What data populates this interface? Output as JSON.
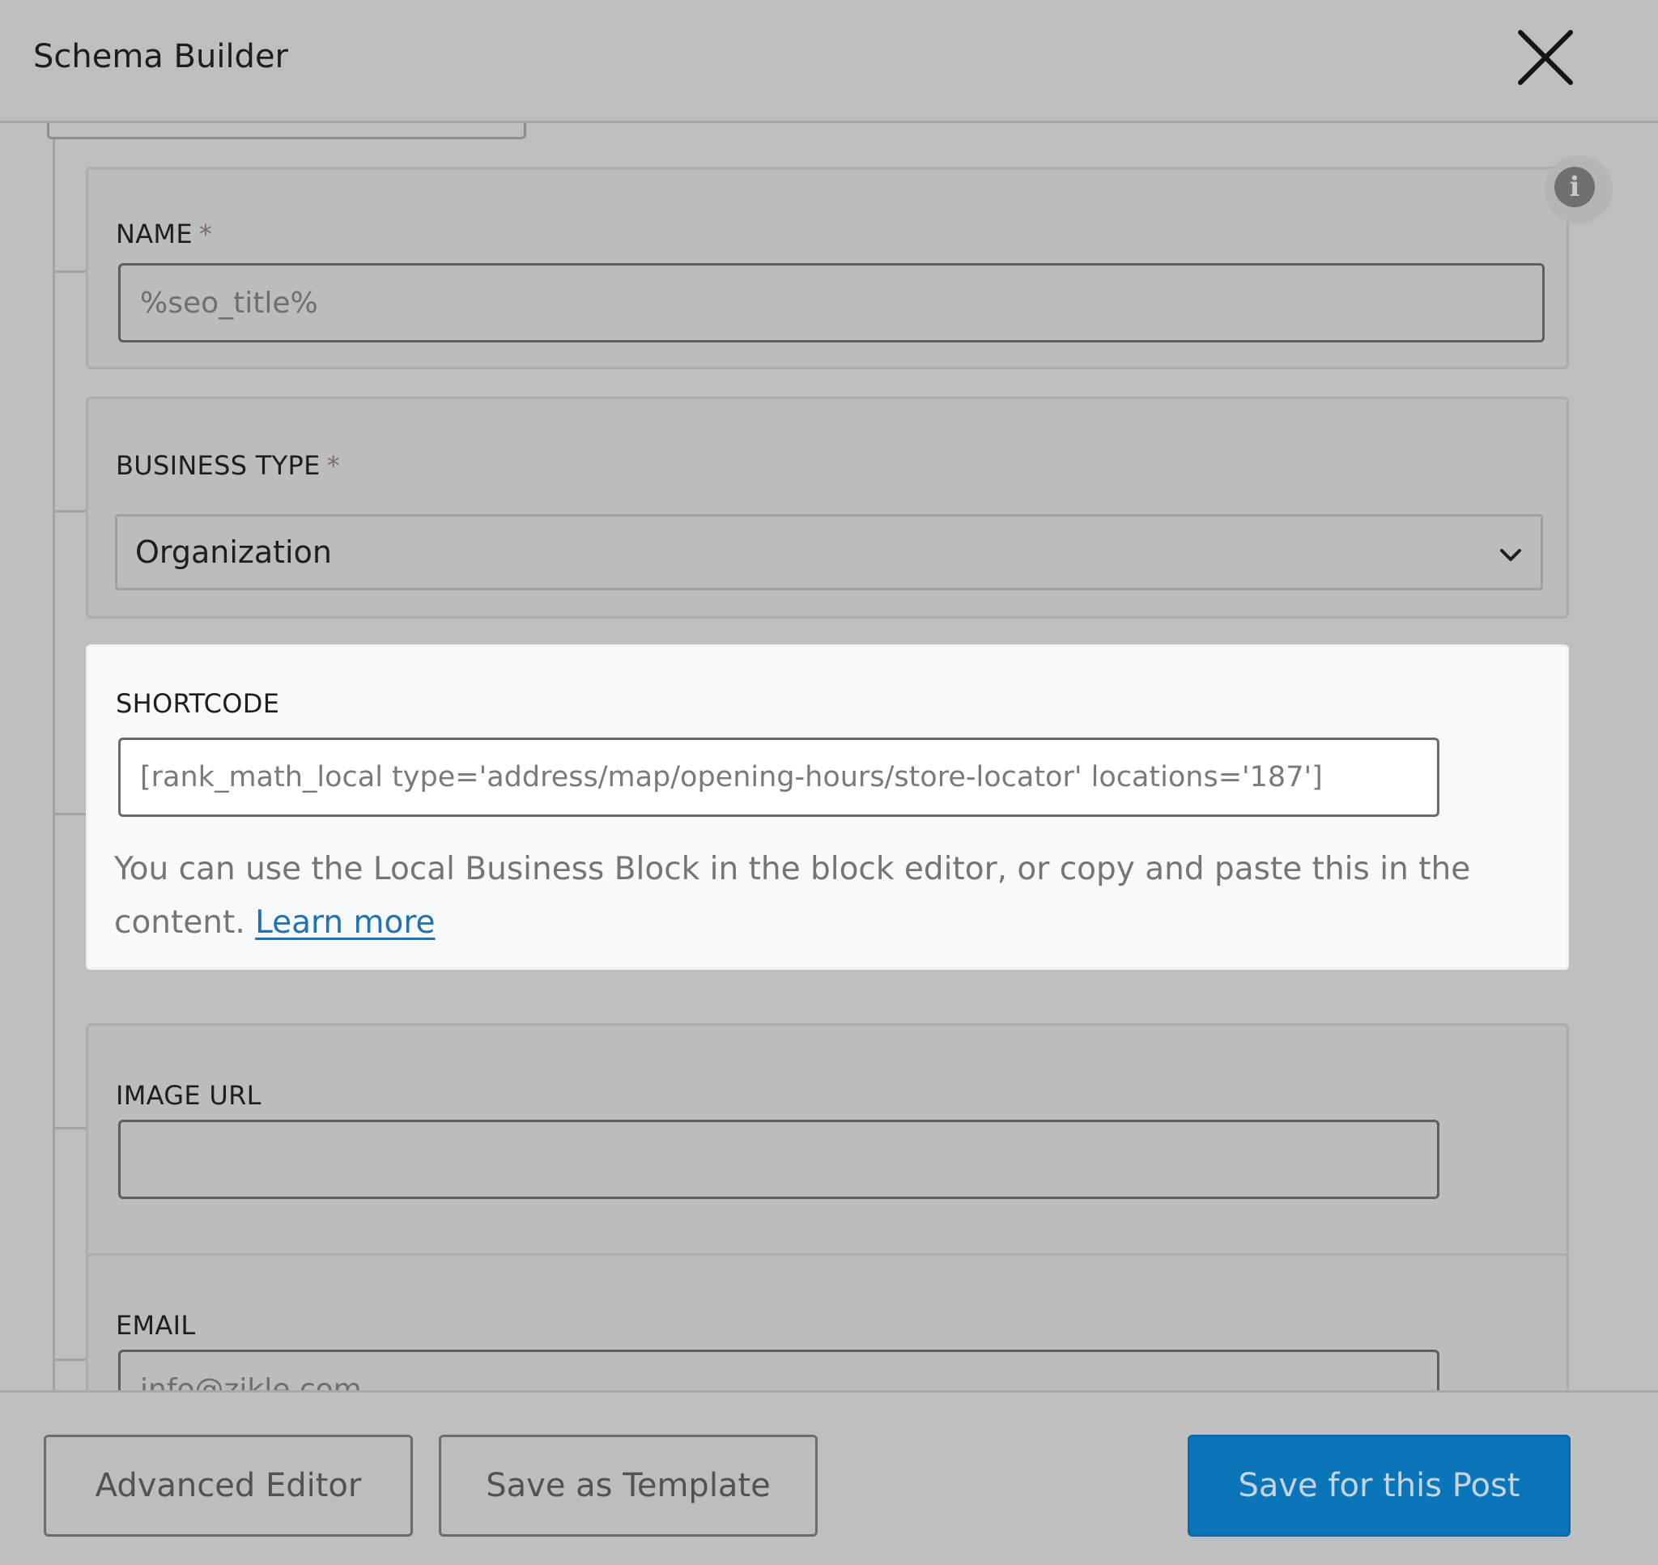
{
  "header": {
    "title": "Schema Builder"
  },
  "fields": {
    "name": {
      "label": "NAME",
      "required_mark": "*",
      "value": "%seo_title%"
    },
    "business_type": {
      "label": "BUSINESS TYPE",
      "required_mark": "*",
      "selected": "Organization"
    },
    "shortcode": {
      "label": "SHORTCODE",
      "value": "[rank_math_local type='address/map/opening-hours/store-locator' locations='187']",
      "help_text": "You can use the Local Business Block in the block editor, or copy and paste this in the content.",
      "help_link": "Learn more"
    },
    "image_url": {
      "label": "IMAGE URL",
      "value": ""
    },
    "email": {
      "label": "EMAIL",
      "value": "info@zikle.com"
    }
  },
  "footer": {
    "advanced_editor_label": "Advanced Editor",
    "save_template_label": "Save as Template",
    "save_post_label": "Save for this Post"
  },
  "icons": {
    "close": "close-icon",
    "info": "info-icon",
    "dropdown": "chevron-down-icon"
  },
  "colors": {
    "primary_button": "#0a76b9",
    "link": "#2271b1",
    "overlay": "#bebebe",
    "active_card": "#f8f9fa"
  }
}
